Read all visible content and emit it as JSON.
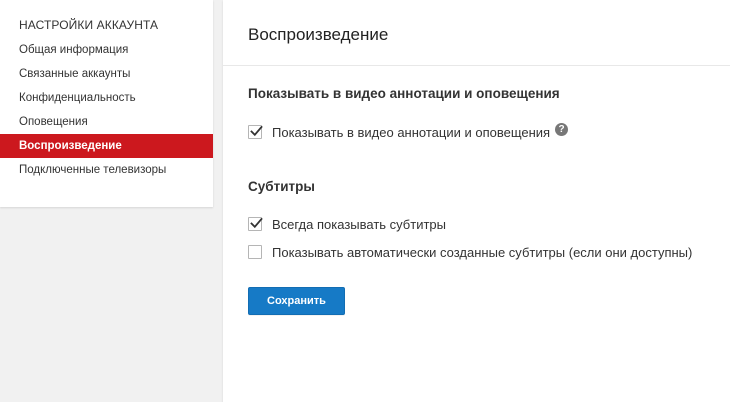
{
  "sidebar": {
    "title": "НАСТРОЙКИ АККАУНТА",
    "items": [
      {
        "label": "Общая информация"
      },
      {
        "label": "Связанные аккаунты"
      },
      {
        "label": "Конфиденциальность"
      },
      {
        "label": "Оповещения"
      },
      {
        "label": "Воспроизведение",
        "active": true
      },
      {
        "label": "Подключенные телевизоры"
      }
    ]
  },
  "main": {
    "title": "Воспроизведение",
    "annotations": {
      "heading": "Показывать в видео аннотации и оповещения",
      "option": {
        "label": "Показывать в видео аннотации и оповещения",
        "checked": true,
        "help_icon": "question-circle-icon"
      }
    },
    "subtitles": {
      "heading": "Субтитры",
      "options": [
        {
          "label": "Всегда показывать субтитры",
          "checked": true
        },
        {
          "label": "Показывать автоматически созданные субтитры (если они доступны)",
          "checked": false
        }
      ]
    },
    "save_label": "Сохранить"
  },
  "colors": {
    "accent_red": "#cc181e",
    "button_blue": "#167ac6",
    "background": "#f1f1f1"
  }
}
